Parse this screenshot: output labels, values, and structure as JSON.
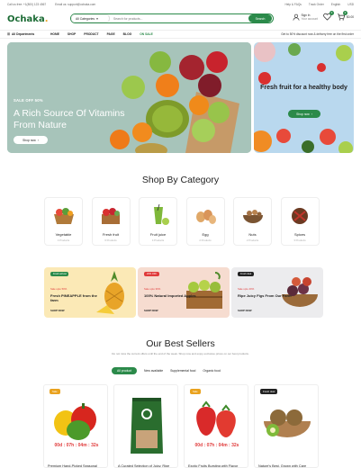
{
  "topbar": {
    "phone": "Call us free: +1(800) 123 4567",
    "email": "Email us: support@ochaka.com",
    "links": [
      "Help & FAQs",
      "Track Order",
      "English",
      "USD"
    ]
  },
  "header": {
    "logo": "Ochaka",
    "logo_dot": ".",
    "search_category": "All Categories",
    "search_placeholder": "Search for products...",
    "search_button": "Search",
    "account_line1": "Sign In",
    "account_line2": "Your account",
    "wishlist_count": "0",
    "cart_count": "0",
    "cart_total": "$0.00"
  },
  "nav": {
    "all_departments": "All Departments",
    "links": [
      "HOME",
      "SHOP",
      "PRODUCT",
      "PAGE",
      "BLOG",
      "ON SALE"
    ],
    "promo": "Get to 50% discount now & delivery free on the first order"
  },
  "hero": {
    "sale": "SALE OFF 50%",
    "title": "A Rich Source Of Vitamins From Nature",
    "button": "Shop now"
  },
  "hero2": {
    "title": "Fresh fruit for a healthy body",
    "button": "Shop now"
  },
  "categories_section": {
    "title": "Shop By Category",
    "items": [
      {
        "name": "Vegetable",
        "count": "4 Products"
      },
      {
        "name": "Fresh fruit",
        "count": "6 Products"
      },
      {
        "name": "Fruit juice",
        "count": "4 Products"
      },
      {
        "name": "Egg",
        "count": "2 Products"
      },
      {
        "name": "Nuts",
        "count": "2 Products"
      },
      {
        "name": "Spices",
        "count": "3 Products"
      }
    ]
  },
  "promos": [
    {
      "tag": "Fresh arrival",
      "label": "Sale upto 50%",
      "title": "Fresh PINEAPPLE from the farm",
      "shop": "SHOP NOW"
    },
    {
      "tag": "20% OFF",
      "label": "Sale upto 30%",
      "title": "100% Natural Imported Apples",
      "shop": "SHOP NOW"
    },
    {
      "tag": "Fresh deal",
      "label": "Sale upto 40%",
      "title": "Ripe Juicy Figs From Our Farm",
      "shop": "SHOP NOW"
    }
  ],
  "best_sellers": {
    "title": "Our Best Sellers",
    "subtitle": "Do not miss the current offers until the end of the week. Shop now and enjoy exclusive prices on our best products.",
    "tabs": [
      "All product",
      "New available",
      "Supplemental food",
      "Organic food"
    ],
    "products": [
      {
        "badge": "Sale",
        "timer": "00d : 07h : 04m : 32s",
        "name": "Premium Hand-Picked Seasonal"
      },
      {
        "badge": "",
        "timer": "",
        "name": "A Curated Selection of Juicy, Ripe"
      },
      {
        "badge": "Sale",
        "timer": "00d : 07h : 04m : 32s",
        "name": "Exotic Fruits Bursting with Flavor"
      },
      {
        "badge": "Fresh deal",
        "timer": "",
        "name": "Nature's Best, Grown with Care"
      }
    ]
  },
  "colors": {
    "brand": "#2b8a4a",
    "accent": "#e9a21f",
    "sale": "#e03b3b"
  }
}
